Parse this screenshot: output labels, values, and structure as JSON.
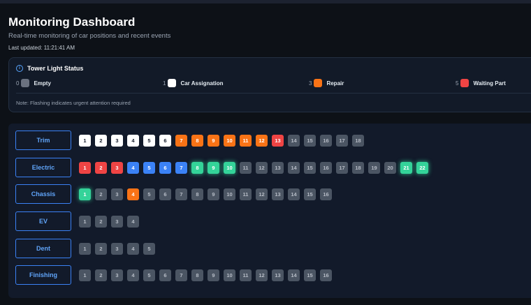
{
  "header": {
    "title": "Monitoring Dashboard",
    "subtitle": "Real-time monitoring of car positions and recent events",
    "last_updated": "Last updated: 11:21:41 AM"
  },
  "tower_status": {
    "title": "Tower Light Status",
    "legend": [
      {
        "code": "0",
        "label": "Empty",
        "color": "#6b7280"
      },
      {
        "code": "1",
        "label": "Car Assignation",
        "color": "#ffffff"
      },
      {
        "code": "3",
        "label": "Repair",
        "color": "#f97316"
      },
      {
        "code": "5",
        "label": "Waiting Part",
        "color": "#ef4444"
      }
    ],
    "note": "Note: Flashing indicates urgent attention required"
  },
  "colors": {
    "empty": "#4b5563",
    "assign": "#ffffff",
    "repair": "#f97316",
    "wait": "#ef4444",
    "blue": "#3b82f6",
    "green": "#34d399",
    "accent": "#3b82f6"
  },
  "lines": [
    {
      "name": "Trim",
      "slots": [
        {
          "n": "1",
          "s": "assign"
        },
        {
          "n": "2",
          "s": "assign"
        },
        {
          "n": "3",
          "s": "assign"
        },
        {
          "n": "4",
          "s": "assign"
        },
        {
          "n": "5",
          "s": "assign"
        },
        {
          "n": "6",
          "s": "assign"
        },
        {
          "n": "7",
          "s": "repair"
        },
        {
          "n": "8",
          "s": "repair"
        },
        {
          "n": "9",
          "s": "repair"
        },
        {
          "n": "10",
          "s": "repair"
        },
        {
          "n": "11",
          "s": "repair"
        },
        {
          "n": "12",
          "s": "repair"
        },
        {
          "n": "13",
          "s": "wait"
        },
        {
          "n": "14",
          "s": "empty"
        },
        {
          "n": "15",
          "s": "empty"
        },
        {
          "n": "16",
          "s": "empty"
        },
        {
          "n": "17",
          "s": "empty"
        },
        {
          "n": "18",
          "s": "empty"
        }
      ]
    },
    {
      "name": "Electric",
      "slots": [
        {
          "n": "1",
          "s": "wait"
        },
        {
          "n": "2",
          "s": "wait"
        },
        {
          "n": "3",
          "s": "wait"
        },
        {
          "n": "4",
          "s": "blue"
        },
        {
          "n": "5",
          "s": "blue"
        },
        {
          "n": "6",
          "s": "blue"
        },
        {
          "n": "7",
          "s": "blue"
        },
        {
          "n": "8",
          "s": "green"
        },
        {
          "n": "9",
          "s": "green"
        },
        {
          "n": "10",
          "s": "green"
        },
        {
          "n": "11",
          "s": "empty"
        },
        {
          "n": "12",
          "s": "empty"
        },
        {
          "n": "13",
          "s": "empty"
        },
        {
          "n": "14",
          "s": "empty"
        },
        {
          "n": "15",
          "s": "empty"
        },
        {
          "n": "16",
          "s": "empty"
        },
        {
          "n": "17",
          "s": "empty"
        },
        {
          "n": "18",
          "s": "empty"
        },
        {
          "n": "19",
          "s": "empty"
        },
        {
          "n": "20",
          "s": "empty"
        },
        {
          "n": "21",
          "s": "green"
        },
        {
          "n": "22",
          "s": "green"
        }
      ]
    },
    {
      "name": "Chassis",
      "slots": [
        {
          "n": "1",
          "s": "green"
        },
        {
          "n": "2",
          "s": "empty"
        },
        {
          "n": "3",
          "s": "empty"
        },
        {
          "n": "4",
          "s": "repair"
        },
        {
          "n": "5",
          "s": "empty"
        },
        {
          "n": "6",
          "s": "empty"
        },
        {
          "n": "7",
          "s": "empty"
        },
        {
          "n": "8",
          "s": "empty"
        },
        {
          "n": "9",
          "s": "empty"
        },
        {
          "n": "10",
          "s": "empty"
        },
        {
          "n": "11",
          "s": "empty"
        },
        {
          "n": "12",
          "s": "empty"
        },
        {
          "n": "13",
          "s": "empty"
        },
        {
          "n": "14",
          "s": "empty"
        },
        {
          "n": "15",
          "s": "empty"
        },
        {
          "n": "16",
          "s": "empty"
        }
      ]
    },
    {
      "name": "EV",
      "slots": [
        {
          "n": "1",
          "s": "empty"
        },
        {
          "n": "2",
          "s": "empty"
        },
        {
          "n": "3",
          "s": "empty"
        },
        {
          "n": "4",
          "s": "empty"
        }
      ]
    },
    {
      "name": "Dent",
      "slots": [
        {
          "n": "1",
          "s": "empty"
        },
        {
          "n": "2",
          "s": "empty"
        },
        {
          "n": "3",
          "s": "empty"
        },
        {
          "n": "4",
          "s": "empty"
        },
        {
          "n": "5",
          "s": "empty"
        }
      ]
    },
    {
      "name": "Finishing",
      "slots": [
        {
          "n": "1",
          "s": "empty"
        },
        {
          "n": "2",
          "s": "empty"
        },
        {
          "n": "3",
          "s": "empty"
        },
        {
          "n": "4",
          "s": "empty"
        },
        {
          "n": "5",
          "s": "empty"
        },
        {
          "n": "6",
          "s": "empty"
        },
        {
          "n": "7",
          "s": "empty"
        },
        {
          "n": "8",
          "s": "empty"
        },
        {
          "n": "9",
          "s": "empty"
        },
        {
          "n": "10",
          "s": "empty"
        },
        {
          "n": "11",
          "s": "empty"
        },
        {
          "n": "12",
          "s": "empty"
        },
        {
          "n": "13",
          "s": "empty"
        },
        {
          "n": "14",
          "s": "empty"
        },
        {
          "n": "15",
          "s": "empty"
        },
        {
          "n": "16",
          "s": "empty"
        }
      ]
    }
  ]
}
